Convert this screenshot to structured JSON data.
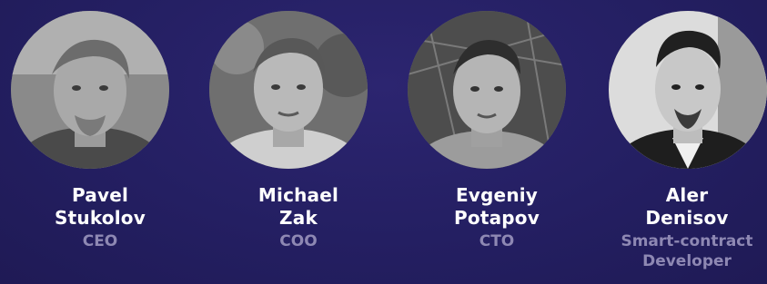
{
  "team": {
    "members": [
      {
        "first_name": "Pavel",
        "last_name": "Stukolov",
        "role": "CEO",
        "role_line2": ""
      },
      {
        "first_name": "Michael",
        "last_name": "Zak",
        "role": "COO",
        "role_line2": ""
      },
      {
        "first_name": "Evgeniy",
        "last_name": "Potapov",
        "role": "CTO",
        "role_line2": ""
      },
      {
        "first_name": "Aler",
        "last_name": "Denisov",
        "role": "Smart-contract",
        "role_line2": "Developer"
      }
    ]
  },
  "colors": {
    "background": "#241f62",
    "name_text": "#ffffff",
    "role_text": "#8e88b3"
  }
}
